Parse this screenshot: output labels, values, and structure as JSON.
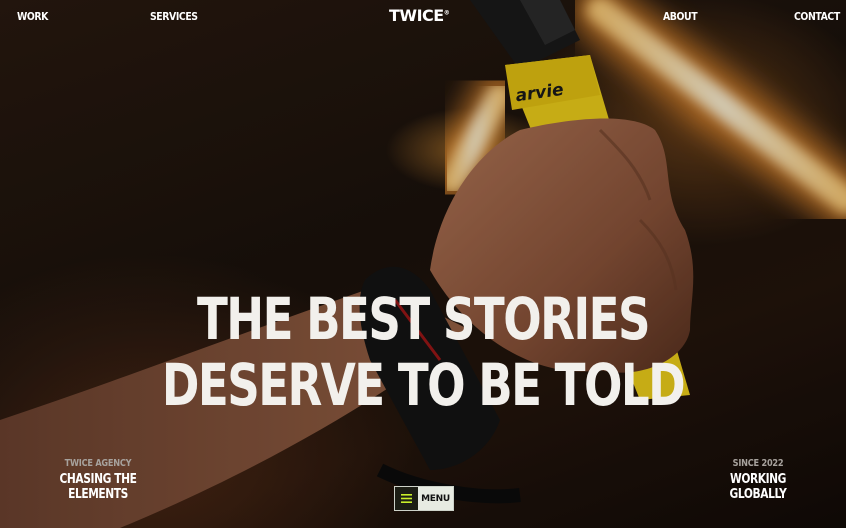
{
  "nav": {
    "work": "WORK",
    "services": "SERVICES",
    "logo": "TWICE",
    "logo_mark": "®",
    "about": "ABOUT",
    "contact": "CONTACT"
  },
  "hero": {
    "line1": "THE BEST STORIES",
    "line2": "DESERVE TO BE TOLD",
    "racket_text": "arvie"
  },
  "left_caption": {
    "small": "TWICE AGENCY",
    "big": "CHASING THE ELEMENTS"
  },
  "right_caption": {
    "small": "SINCE 2022",
    "big": "WORKING GLOBALLY"
  },
  "menu": {
    "label": "MENU",
    "icon": "hamburger-icon",
    "accent": "#c9f02a"
  },
  "colors": {
    "glow": "#ffb04a",
    "grip": "#f2d21a"
  }
}
